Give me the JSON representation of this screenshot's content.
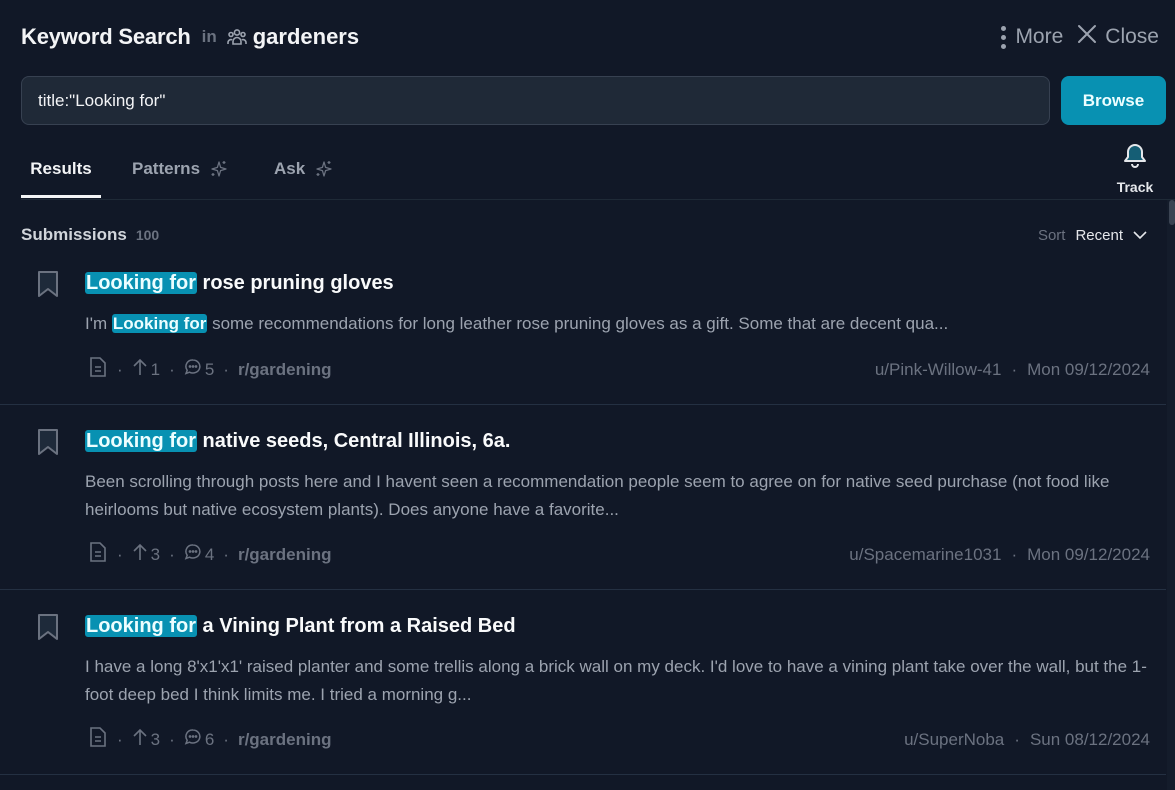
{
  "header": {
    "title": "Keyword Search",
    "in_word": "in",
    "community_icon": "group-icon",
    "community": "gardeners",
    "more_label": "More",
    "close_label": "Close"
  },
  "search": {
    "value": "title:\"Looking for\"",
    "button_label": "Browse"
  },
  "tabs": [
    {
      "label": "Results",
      "active": true
    },
    {
      "label": "Patterns",
      "icon": "sparkle-icon"
    },
    {
      "label": "Ask",
      "icon": "sparkle-icon"
    }
  ],
  "track": {
    "label": "Track",
    "icon": "bell-icon"
  },
  "list": {
    "label": "Submissions",
    "count": "100",
    "sort_label": "Sort",
    "sort_value": "Recent"
  },
  "colors": {
    "accent": "#0891b2",
    "background": "#111827"
  },
  "items": [
    {
      "title_highlight": "Looking for",
      "title_rest": " rose pruning gloves",
      "body_prefix": "I'm ",
      "body_highlight": "Looking for",
      "body_rest": " some recommendations for long leather rose pruning gloves as a gift. Some that are decent qua...",
      "upvotes": "1",
      "comments": "5",
      "subreddit": "r/gardening",
      "author": "u/Pink-Willow-41",
      "date": "Mon 09/12/2024"
    },
    {
      "title_highlight": "Looking for",
      "title_rest": " native seeds, Central Illinois, 6a.",
      "body_prefix": "",
      "body_highlight": "",
      "body_rest": "Been scrolling through posts here and I havent seen a recommendation people seem to agree on for native seed purchase (not food like heirlooms but native ecosystem plants). Does anyone have a favorite...",
      "upvotes": "3",
      "comments": "4",
      "subreddit": "r/gardening",
      "author": "u/Spacemarine1031",
      "date": "Mon 09/12/2024"
    },
    {
      "title_highlight": "Looking for",
      "title_rest": " a Vining Plant from a Raised Bed",
      "body_prefix": "",
      "body_highlight": "",
      "body_rest": "I have a long 8'x1'x1' raised planter and some trellis along a brick wall on my deck. I'd love to have a vining plant take over the wall, but the 1-foot deep bed I think limits me. I tried a morning g...",
      "upvotes": "3",
      "comments": "6",
      "subreddit": "r/gardening",
      "author": "u/SuperNoba",
      "date": "Sun 08/12/2024"
    }
  ]
}
